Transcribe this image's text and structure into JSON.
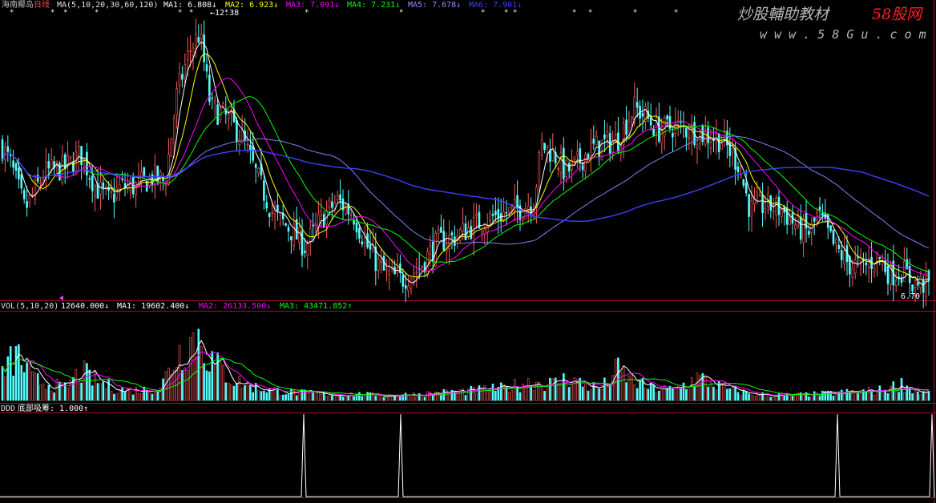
{
  "header": {
    "stock_name": "海南椰岛",
    "period": "日线",
    "ma_label": "MA(5,10,20,30,60,120)",
    "ma1": "MA1: 6.808↓",
    "ma2": "MA2: 6.923↓",
    "ma3": "MA3: 7.091↓",
    "ma4": "MA4: 7.231↓",
    "ma5": "MA5: 7.678↓",
    "ma6": "MA6: 7.901↓"
  },
  "price_panel": {
    "high_marker": "←12.38",
    "low_marker": "6.70"
  },
  "volume_panel": {
    "label": "VOL(5,10,20)",
    "vol": "12640.000↓",
    "ma1": "MA1: 19602.400↓",
    "ma2": "MA2: 26133.500↓",
    "ma3": "MA3: 43471.852↑"
  },
  "indicator_panel": {
    "name": "DDD",
    "label": "底部吸筹: 1.000↑"
  },
  "watermark": {
    "line1": "炒股輔助教材",
    "brand": "58股网",
    "line2": "w w w . 5 8 G u . c o m"
  },
  "colors": {
    "up": "#ff5a5a",
    "down": "#54ffff",
    "ma1": "#ffffff",
    "ma2": "#ffff00",
    "ma3": "#ff00ff",
    "ma4": "#00ff00",
    "ma5": "#8080ff",
    "ma6": "#4040ff",
    "border": "#a01030",
    "header_white": "#e0e0e0"
  },
  "chart_data": [
    {
      "type": "candlestick",
      "title": "海南椰岛 日线",
      "series_names": [
        "MA1",
        "MA2",
        "MA3",
        "MA4",
        "MA5",
        "MA6"
      ],
      "ma_periods": [
        5,
        10,
        20,
        30,
        60,
        120
      ],
      "latest_ma_values": [
        6.808,
        6.923,
        7.091,
        7.231,
        7.678,
        7.901
      ],
      "marked_high": 12.38,
      "marked_low": 6.7,
      "ylim": [
        6.5,
        12.6
      ],
      "anchor_closes": [
        [
          0,
          9.8
        ],
        [
          12,
          9.4
        ],
        [
          30,
          8.4
        ],
        [
          55,
          9.2
        ],
        [
          80,
          9.3
        ],
        [
          100,
          9.6
        ],
        [
          118,
          8.9
        ],
        [
          135,
          8.6
        ],
        [
          150,
          8.9
        ],
        [
          170,
          8.9
        ],
        [
          190,
          9.1
        ],
        [
          205,
          9.0
        ],
        [
          220,
          10.9
        ],
        [
          235,
          11.8
        ],
        [
          248,
          12.2
        ],
        [
          262,
          10.6
        ],
        [
          280,
          10.4
        ],
        [
          300,
          10.0
        ],
        [
          320,
          9.1
        ],
        [
          340,
          8.3
        ],
        [
          360,
          8.0
        ],
        [
          380,
          7.6
        ],
        [
          400,
          8.2
        ],
        [
          420,
          8.6
        ],
        [
          440,
          8.3
        ],
        [
          460,
          7.5
        ],
        [
          480,
          7.0
        ],
        [
          500,
          6.9
        ],
        [
          520,
          7.1
        ],
        [
          545,
          7.7
        ],
        [
          565,
          7.8
        ],
        [
          585,
          8.0
        ],
        [
          605,
          8.2
        ],
        [
          625,
          8.3
        ],
        [
          645,
          8.4
        ],
        [
          665,
          8.6
        ],
        [
          675,
          9.8
        ],
        [
          690,
          9.6
        ],
        [
          705,
          9.2
        ],
        [
          720,
          9.4
        ],
        [
          735,
          9.7
        ],
        [
          750,
          9.8
        ],
        [
          770,
          9.9
        ],
        [
          790,
          10.6
        ],
        [
          805,
          10.4
        ],
        [
          820,
          10.1
        ],
        [
          840,
          10.2
        ],
        [
          860,
          10.1
        ],
        [
          880,
          10.0
        ],
        [
          900,
          9.9
        ],
        [
          920,
          9.4
        ],
        [
          935,
          8.4
        ],
        [
          955,
          8.5
        ],
        [
          975,
          8.4
        ],
        [
          995,
          8.0
        ],
        [
          1010,
          7.9
        ],
        [
          1020,
          8.3
        ],
        [
          1040,
          7.6
        ],
        [
          1060,
          7.2
        ],
        [
          1080,
          7.2
        ],
        [
          1095,
          7.4
        ],
        [
          1110,
          7.0
        ],
        [
          1125,
          7.1
        ],
        [
          1140,
          6.8
        ],
        [
          1160,
          6.8
        ]
      ]
    },
    {
      "type": "bar",
      "title": "VOL(5,10,20)",
      "series_names": [
        "VOL",
        "MA1",
        "MA2",
        "MA3"
      ],
      "latest_values": [
        12640.0,
        19602.4,
        26133.5,
        43471.852
      ],
      "ylim": [
        0,
        210000
      ],
      "anchor_volumes": [
        [
          0,
          60000
        ],
        [
          20,
          110000
        ],
        [
          40,
          50000
        ],
        [
          60,
          40000
        ],
        [
          80,
          30000
        ],
        [
          100,
          70000
        ],
        [
          120,
          45000
        ],
        [
          140,
          30000
        ],
        [
          160,
          25000
        ],
        [
          180,
          25000
        ],
        [
          200,
          35000
        ],
        [
          220,
          110000
        ],
        [
          245,
          160000
        ],
        [
          265,
          90000
        ],
        [
          290,
          50000
        ],
        [
          320,
          30000
        ],
        [
          360,
          20000
        ],
        [
          400,
          15000
        ],
        [
          440,
          15000
        ],
        [
          480,
          12000
        ],
        [
          520,
          15000
        ],
        [
          560,
          20000
        ],
        [
          600,
          25000
        ],
        [
          630,
          30000
        ],
        [
          660,
          45000
        ],
        [
          690,
          40000
        ],
        [
          710,
          55000
        ],
        [
          730,
          35000
        ],
        [
          750,
          30000
        ],
        [
          770,
          75000
        ],
        [
          790,
          45000
        ],
        [
          810,
          30000
        ],
        [
          840,
          25000
        ],
        [
          870,
          55000
        ],
        [
          890,
          40000
        ],
        [
          910,
          25000
        ],
        [
          940,
          15000
        ],
        [
          980,
          12000
        ],
        [
          1020,
          15000
        ],
        [
          1060,
          20000
        ],
        [
          1100,
          25000
        ],
        [
          1125,
          40000
        ],
        [
          1145,
          20000
        ],
        [
          1165,
          15000
        ]
      ]
    },
    {
      "type": "line",
      "title": "底部吸筹",
      "signal_value": 1.0,
      "signal_positions": [
        379,
        500,
        1045,
        1163
      ],
      "ylim": [
        0,
        1
      ]
    }
  ]
}
